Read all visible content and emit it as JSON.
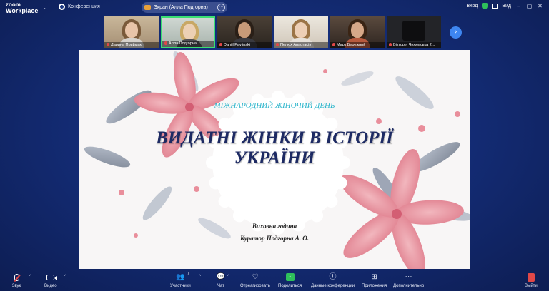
{
  "app": {
    "logo_line1": "zoom",
    "logo_line2": "Workplace"
  },
  "topbar": {
    "conference_label": "Конференция",
    "screen_share_label": "Экран (Алла Подгорна)",
    "signin_label": "Вход",
    "view_label": "Вид"
  },
  "participants": [
    {
      "name": "Дарина Приймак"
    },
    {
      "name": "Алла Подгорна"
    },
    {
      "name": "Daniil Pavlinski"
    },
    {
      "name": "Пелюх Анастасія"
    },
    {
      "name": "Марк Бережний"
    },
    {
      "name": "Вікторія Чижевська 2..."
    }
  ],
  "slide": {
    "subtitle": "МІЖНАРОДНИЙ ЖІНОЧИЙ ДЕНЬ",
    "title_line1": "ВИДАТНІ ЖІНКИ В ІСТОРІЇ",
    "title_line2": "УКРАЇНИ",
    "event_type": "Виховна година",
    "curator": "Куратор Подгорна А. О."
  },
  "toolbar": {
    "audio": "Звук",
    "video": "Видео",
    "participants": "Участники",
    "participants_count": "7",
    "chat": "Чат",
    "react": "Отреагировать",
    "share": "Поделиться",
    "info": "Данные конференции",
    "apps": "Приложения",
    "more": "Дополнительно",
    "leave": "Выйти"
  },
  "colors": {
    "accent_green": "#2ec05b",
    "accent_blue": "#3e86f0",
    "title_navy": "#1d2a63",
    "subtitle_teal": "#2fb6cc",
    "leave_red": "#e04848"
  }
}
